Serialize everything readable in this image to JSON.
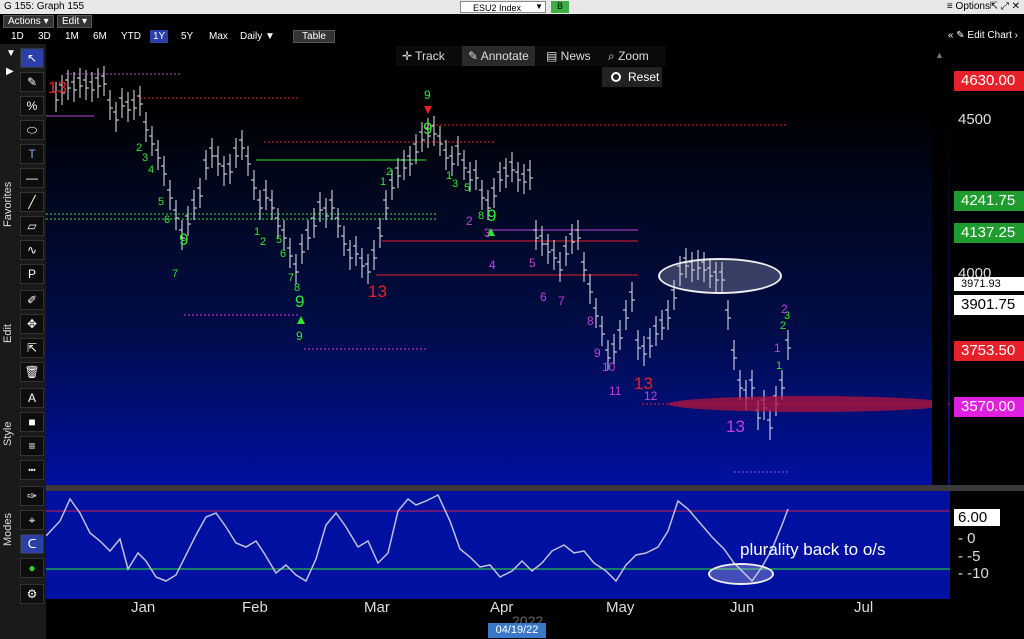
{
  "window": {
    "title": "G 155: Graph 155",
    "ticker": "ESU2 Index",
    "ticker_indicator": "B",
    "options": "≡ Options",
    "window_controls": "⇱ ⤢ ✕"
  },
  "menu": {
    "actions": "Actions ▾",
    "edit": "Edit ▾"
  },
  "ranges": [
    "1D",
    "3D",
    "1M",
    "6M",
    "YTD",
    "1Y",
    "5Y",
    "Max",
    "Daily ▼"
  ],
  "active_range": "1Y",
  "toolbar": {
    "table": "Table",
    "edit_chart": "« ✎ Edit Chart ›",
    "track": "Track",
    "annotate": "Annotate",
    "news": "News",
    "zoom": "Zoom",
    "reset": "Reset"
  },
  "side_labels": {
    "favorites": "Favorites",
    "edit": "Edit",
    "style": "Style",
    "modes": "Modes"
  },
  "y_ticks": [
    {
      "label": "4500",
      "value": 4500
    },
    {
      "label": "4000",
      "value": 4000
    }
  ],
  "price_tags": [
    {
      "label": "4630.00",
      "value": 4630,
      "color": "#e8202a"
    },
    {
      "label": "4241.75",
      "value": 4241.75,
      "color": "#1e9c2e"
    },
    {
      "label": "4137.25",
      "value": 4137.25,
      "color": "#1e9c2e"
    },
    {
      "label": "3971.93",
      "value": 3971.93,
      "color": "#ffffff"
    },
    {
      "label": "3901.75",
      "value": 3901.75,
      "color": "#ffffff"
    },
    {
      "label": "3753.50",
      "value": 3753.5,
      "color": "#e8202a"
    },
    {
      "label": "3570.00",
      "value": 3570,
      "color": "#e020e0"
    }
  ],
  "osc_ticks": [
    {
      "label": "6.00",
      "value": 6,
      "boxed": true
    },
    {
      "label": "0",
      "value": 0
    },
    {
      "label": "-5",
      "value": -5
    },
    {
      "label": "-10",
      "value": -10
    }
  ],
  "months": [
    "Jan",
    "Feb",
    "Mar",
    "Apr",
    "May",
    "Jun",
    "Jul"
  ],
  "date_marker": "04/19/22",
  "year_marker": "2022",
  "annotation": "plurality back to o/s",
  "td_counts": {
    "red_13_labels": [
      "13",
      "13",
      "13"
    ],
    "magenta_13": "13",
    "green_9": [
      "9",
      "9",
      "9",
      "9",
      "9"
    ],
    "red_9": "9",
    "green_seq": [
      "1",
      "2",
      "3",
      "4",
      "5",
      "6",
      "7",
      "8"
    ],
    "magenta_seq": [
      "1",
      "2",
      "3",
      "4",
      "5",
      "6",
      "7",
      "8",
      "9",
      "10",
      "11",
      "12"
    ]
  },
  "colors": {
    "background_bottom": "#0010a0",
    "green_count": "#2ee82e",
    "red_count": "#e8202a",
    "magenta_count": "#c040e0",
    "osc_line": "#c0c0d8"
  }
}
